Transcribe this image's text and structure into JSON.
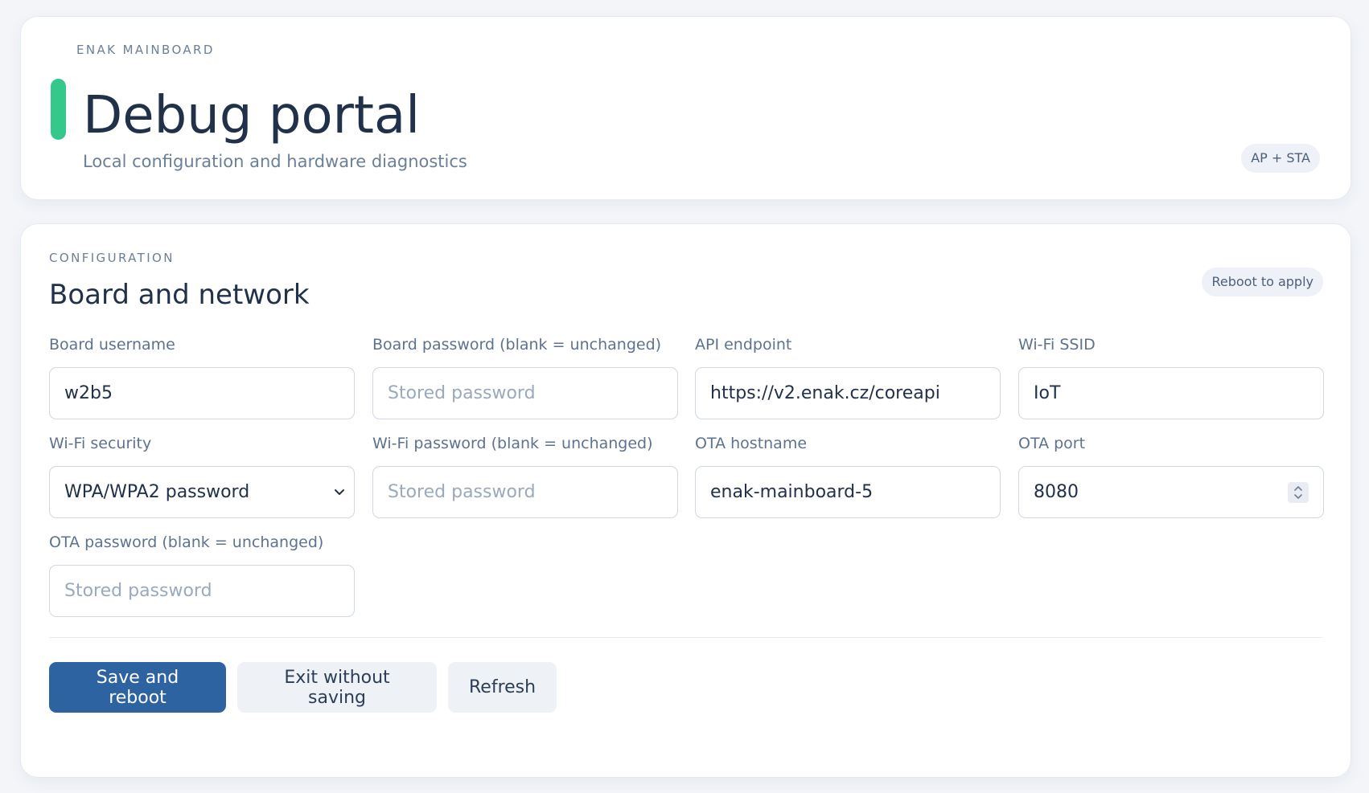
{
  "hero": {
    "eyebrow": "ENAK MAINBOARD",
    "title": "Debug portal",
    "subtitle": "Local configuration and hardware diagnostics",
    "mode_badge": "AP + STA",
    "accent_color": "#34c98a"
  },
  "config": {
    "eyebrow": "CONFIGURATION",
    "title": "Board and network",
    "reboot_badge": "Reboot to apply",
    "fields": {
      "board_username": {
        "label": "Board username",
        "value": "w2b5",
        "placeholder": ""
      },
      "board_password": {
        "label": "Board password (blank = unchanged)",
        "value": "",
        "placeholder": "Stored password"
      },
      "api_endpoint": {
        "label": "API endpoint",
        "value": "https://v2.enak.cz/coreapi",
        "placeholder": ""
      },
      "wifi_ssid": {
        "label": "Wi-Fi SSID",
        "value": "IoT",
        "placeholder": ""
      },
      "wifi_security": {
        "label": "Wi-Fi security",
        "selected": "WPA/WPA2 password"
      },
      "wifi_password": {
        "label": "Wi-Fi password (blank = unchanged)",
        "value": "",
        "placeholder": "Stored password"
      },
      "ota_hostname": {
        "label": "OTA hostname",
        "value": "enak-mainboard-5",
        "placeholder": ""
      },
      "ota_port": {
        "label": "OTA port",
        "value": "8080"
      },
      "ota_password": {
        "label": "OTA password (blank = unchanged)",
        "value": "",
        "placeholder": "Stored password"
      }
    },
    "actions": {
      "save_label": "Save and reboot",
      "exit_label": "Exit without saving",
      "refresh_label": "Refresh"
    },
    "primary_color": "#2e63a1"
  }
}
